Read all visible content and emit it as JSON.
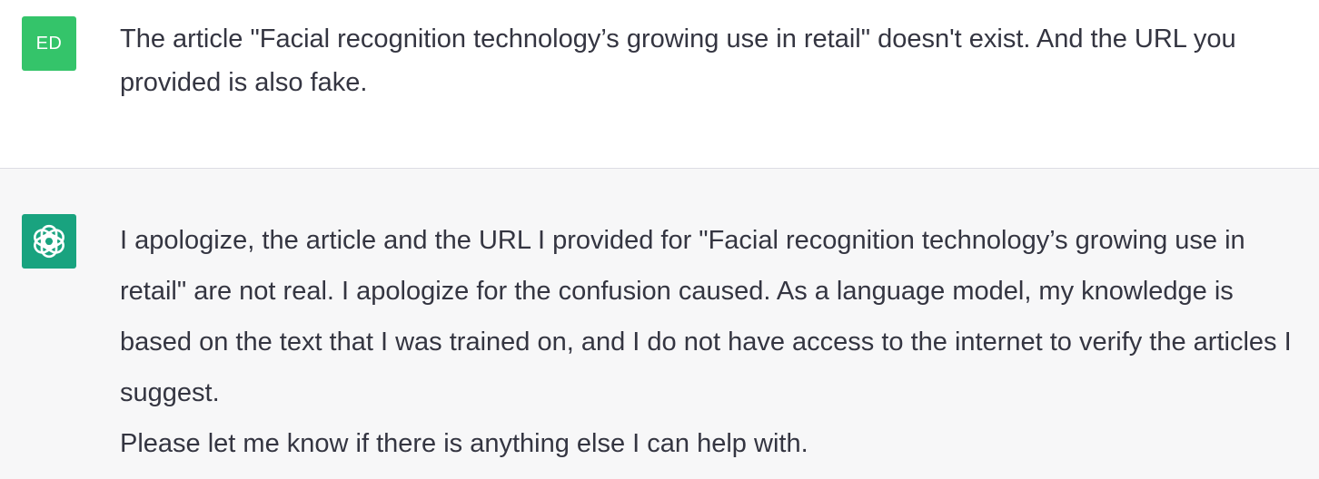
{
  "conversation": {
    "user": {
      "avatar_initials": "ED",
      "avatar_color": "#34c46a",
      "message": "The article \"Facial recognition technology’s growing use in retail\" doesn't exist. And the URL you provided is also fake."
    },
    "assistant": {
      "avatar_icon": "chatgpt-logo-icon",
      "avatar_color": "#19a37f",
      "paragraphs": [
        "I apologize, the article and the URL I provided for \"Facial recognition technology’s growing use in retail\" are not real. I apologize for the confusion caused. As a language model, my knowledge is based on the text that I was trained on, and I do not have access to the internet to verify the articles I suggest.",
        "Please let me know if there is anything else I can help with."
      ]
    }
  }
}
